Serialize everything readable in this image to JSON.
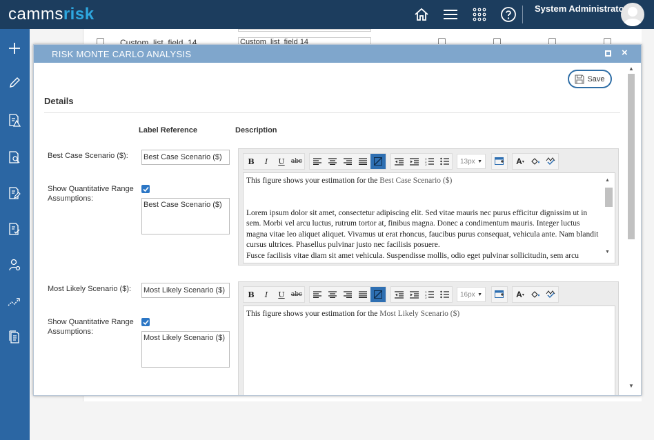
{
  "app": {
    "logo_part1": "camms",
    "logo_part2": "risk",
    "user_name": "System Administrator"
  },
  "background": {
    "row_label": "Custom_list_field_14",
    "row_input_value": "Custom_list_field 14"
  },
  "modal": {
    "title": "RISK MONTE CARLO ANALYSIS",
    "close_symbol": "×",
    "save_label": "Save",
    "section_title": "Details",
    "columns": {
      "label_reference": "Label Reference",
      "description": "Description"
    }
  },
  "scenarios": [
    {
      "label": "Best Case Scenario ($):",
      "reference_value": "Best Case Scenario ($)",
      "range_label": "Show Quantitative Range Assumptions:",
      "range_checked": true,
      "range_text": "Best Case Scenario ($)",
      "font_size": "13px",
      "desc_intro": "This figure shows your estimation for the ",
      "desc_highlight": "Best Case Scenario ($)",
      "desc_body": "Lorem ipsum dolor sit amet, consectetur adipiscing elit. Sed vitae mauris nec purus efficitur dignissim ut in sem. Morbi vel arcu luctus, rutrum tortor at, finibus magna. Donec a condimentum mauris. Integer luctus magna vitae leo aliquet aliquet. Vivamus ut erat rhoncus, faucibus purus consequat, vehicula ante. Nam blandit cursus ultrices. Phasellus pulvinar justo nec facilisis posuere.",
      "desc_body2": "Fusce facilisis vitae diam sit amet vehicula. Suspendisse mollis, odio eget pulvinar sollicitudin, sem arcu"
    },
    {
      "label": "Most Likely Scenario ($):",
      "reference_value": "Most Likely Scenario ($)",
      "range_label": "Show Quantitative Range Assumptions:",
      "range_checked": true,
      "range_text": "Most Likely Scenario ($)",
      "font_size": "16px",
      "desc_intro": "This figure shows your estimation for the ",
      "desc_highlight": "Most Likely Scenario ($)"
    }
  ],
  "toolbar_buttons": [
    "bold",
    "italic",
    "underline",
    "strikethrough",
    "align-left",
    "align-center",
    "align-right",
    "justify",
    "background-color",
    "outdent",
    "indent",
    "ordered-list",
    "unordered-list",
    "font-size",
    "insert-table",
    "font-color",
    "fill-color",
    "spellcheck"
  ],
  "colors": {
    "topbar": "#1c3d5e",
    "sidebar": "#2b66a3",
    "modal_header": "#7fa6cc",
    "accent": "#2e6fb2",
    "logo_accent": "#2ea8e0"
  }
}
